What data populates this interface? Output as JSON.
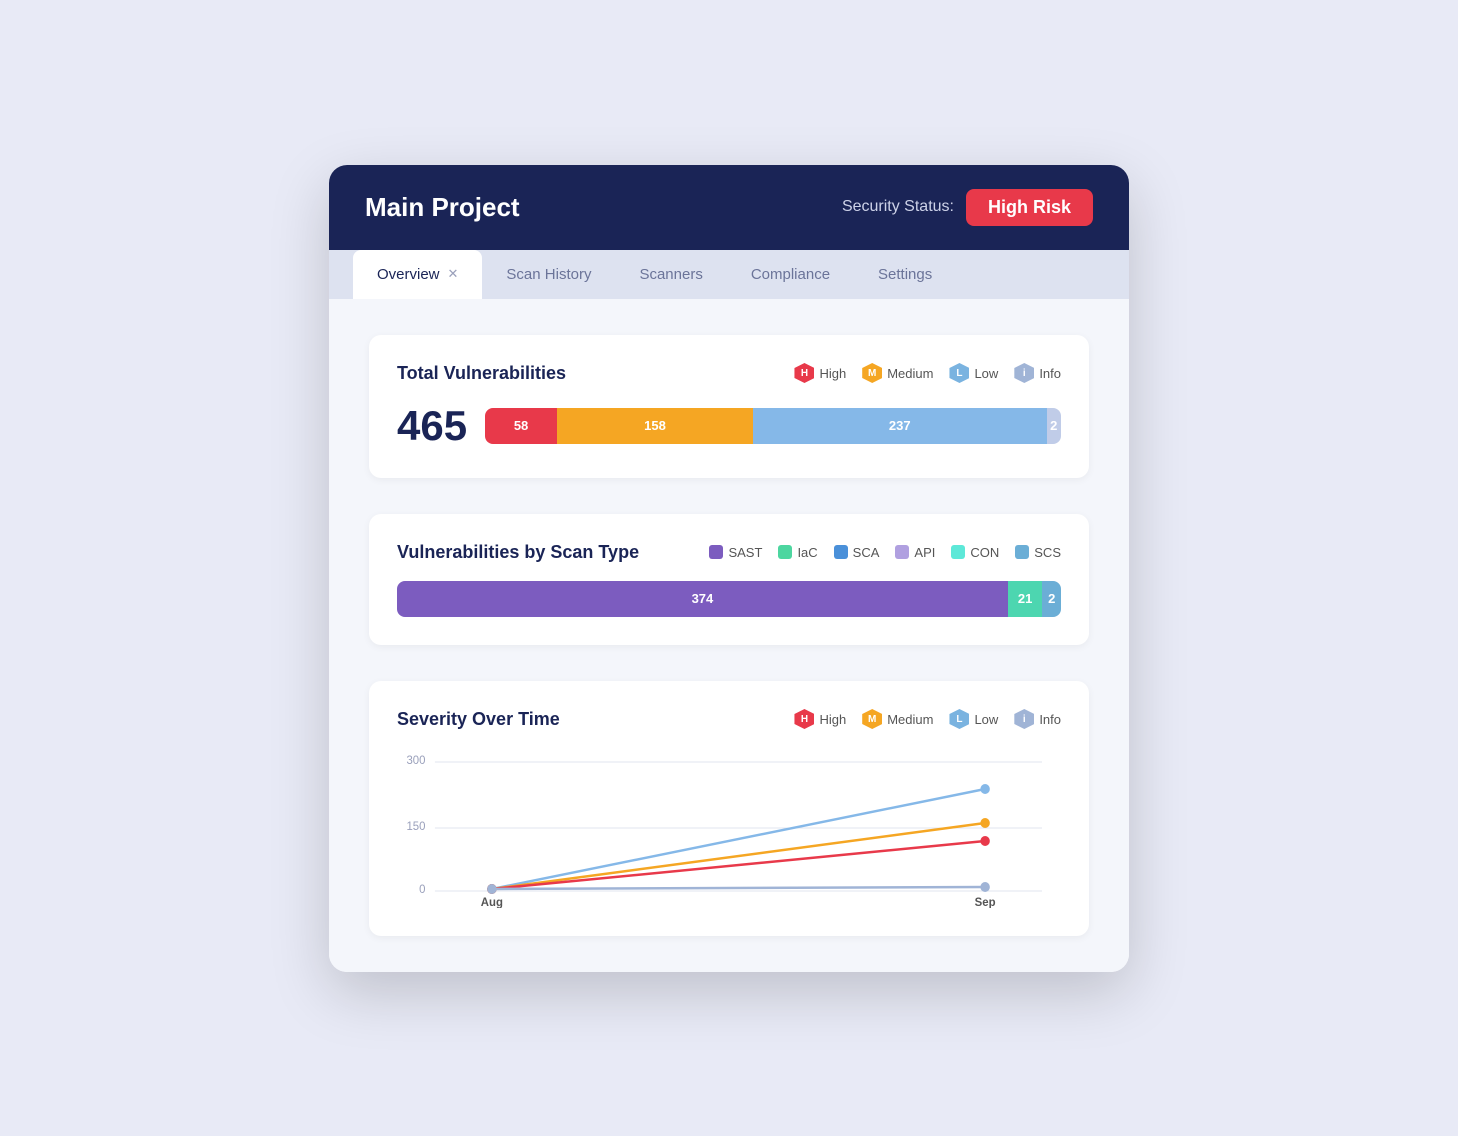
{
  "header": {
    "title": "Main Project",
    "status_label": "Security Status:",
    "risk_badge": "High Risk"
  },
  "tabs": [
    {
      "label": "Overview",
      "active": true,
      "closable": true
    },
    {
      "label": "Scan History",
      "active": false
    },
    {
      "label": "Scanners",
      "active": false
    },
    {
      "label": "Compliance",
      "active": false
    },
    {
      "label": "Settings",
      "active": false
    }
  ],
  "total_vulnerabilities": {
    "section_title": "Total Vulnerabilities",
    "total": "465",
    "legend": [
      {
        "key": "high",
        "label": "High",
        "letter": "H"
      },
      {
        "key": "medium",
        "label": "Medium",
        "letter": "M"
      },
      {
        "key": "low",
        "label": "Low",
        "letter": "L"
      },
      {
        "key": "info",
        "label": "Info",
        "letter": "i"
      }
    ],
    "segments": [
      {
        "label": "58",
        "pct": 12.5,
        "class": "seg-high"
      },
      {
        "label": "158",
        "pct": 34,
        "class": "seg-medium"
      },
      {
        "label": "237",
        "pct": 51,
        "class": "seg-low"
      },
      {
        "label": "2",
        "pct": 0.4,
        "class": "seg-info"
      }
    ]
  },
  "scan_type": {
    "section_title": "Vulnerabilities by Scan Type",
    "legend": [
      {
        "key": "sast",
        "label": "SAST",
        "class": "dot-sast"
      },
      {
        "key": "iac",
        "label": "IaC",
        "class": "dot-iac"
      },
      {
        "key": "sca",
        "label": "SCA",
        "class": "dot-sca"
      },
      {
        "key": "api",
        "label": "API",
        "class": "dot-api"
      },
      {
        "key": "con",
        "label": "CON",
        "class": "dot-con"
      },
      {
        "key": "scs",
        "label": "SCS",
        "class": "dot-scs"
      }
    ],
    "segments": [
      {
        "label": "374",
        "pct": 92,
        "class": "seg-sast"
      },
      {
        "label": "21",
        "pct": 5.2,
        "class": "seg-con"
      },
      {
        "label": "2",
        "pct": 0.5,
        "class": "seg-scs"
      }
    ]
  },
  "severity_over_time": {
    "section_title": "Severity Over Time",
    "legend": [
      {
        "key": "high",
        "label": "High",
        "letter": "H"
      },
      {
        "key": "medium",
        "label": "Medium",
        "letter": "M"
      },
      {
        "key": "low",
        "label": "Low",
        "letter": "L"
      },
      {
        "key": "info",
        "label": "Info",
        "letter": "i"
      }
    ],
    "y_labels": [
      "300",
      "150",
      "0"
    ],
    "x_labels": [
      "Aug",
      "Sep"
    ],
    "lines": [
      {
        "color": "#e8394a",
        "label": "High",
        "aug": 5,
        "sep": 115
      },
      {
        "color": "#f5a623",
        "label": "Medium",
        "aug": 5,
        "sep": 158
      },
      {
        "color": "#85b8e8",
        "label": "Low",
        "aug": 5,
        "sep": 237
      },
      {
        "color": "#a0b4d6",
        "label": "Info",
        "aug": 5,
        "sep": 10
      }
    ],
    "max": 300
  }
}
